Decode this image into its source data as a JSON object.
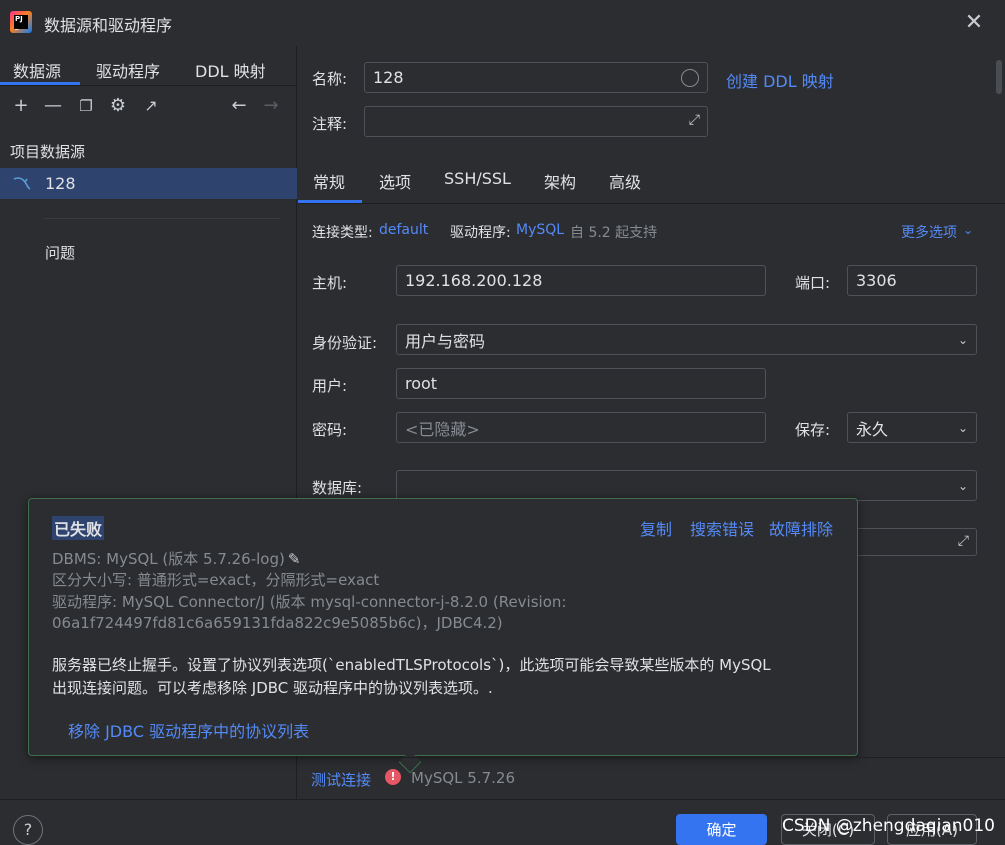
{
  "window": {
    "title": "数据源和驱动程序",
    "close_icon": "close-icon"
  },
  "left": {
    "tabs": [
      "数据源",
      "驱动程序",
      "DDL 映射"
    ],
    "section_title": "项目数据源",
    "datasource": "128",
    "problems": "问题"
  },
  "form": {
    "name_label": "名称:",
    "name_value": "128",
    "create_ddl_link": "创建 DDL 映射",
    "comment_label": "注释:",
    "tabs": [
      "常规",
      "选项",
      "SSH/SSL",
      "架构",
      "高级"
    ],
    "conn_type_label": "连接类型:",
    "conn_type_value": "default",
    "driver_label": "驱动程序:",
    "driver_value": "MySQL",
    "driver_note": "自 5.2 起支持",
    "more_options": "更多选项",
    "host_label": "主机:",
    "host_value": "192.168.200.128",
    "port_label": "端口:",
    "port_value": "3306",
    "auth_label": "身份验证:",
    "auth_value": "用户与密码",
    "user_label": "用户:",
    "user_value": "root",
    "password_label": "密码:",
    "password_placeholder": "<已隐藏>",
    "save_label": "保存:",
    "save_value": "永久",
    "database_label": "数据库:"
  },
  "popup": {
    "title": "已失败",
    "links": [
      "复制",
      "搜索错误",
      "故障排除"
    ],
    "dbms": "DBMS: MySQL (版本 5.7.26-log)",
    "case": "区分大小写: 普通形式=exact，分隔形式=exact",
    "driver1": "驱动程序: MySQL Connector/J (版本 mysql-connector-j-8.2.0 (Revision:",
    "driver2": "06a1f724497fd81c6a659131fda822c9e5085b6c)，JDBC4.2)",
    "msg1": "服务器已终止握手。设置了协议列表选项(`enabledTLSProtocols`)，此选项可能会导致某些版本的 MySQL",
    "msg2": "出现连接问题。可以考虑移除 JDBC 驱动程序中的协议列表选项。.",
    "action": "移除 JDBC 驱动程序中的协议列表"
  },
  "status": {
    "test_link": "测试连接",
    "result": "MySQL 5.7.26"
  },
  "footer": {
    "help": "?",
    "ok": "确定",
    "cancel": "关闭(C)",
    "apply": "应用(A)",
    "watermark": "CSDN @zhengdaqian010"
  },
  "colors": {
    "accent": "#3574f0",
    "link": "#548af7",
    "error": "#e55765",
    "selection": "#2e436e"
  }
}
